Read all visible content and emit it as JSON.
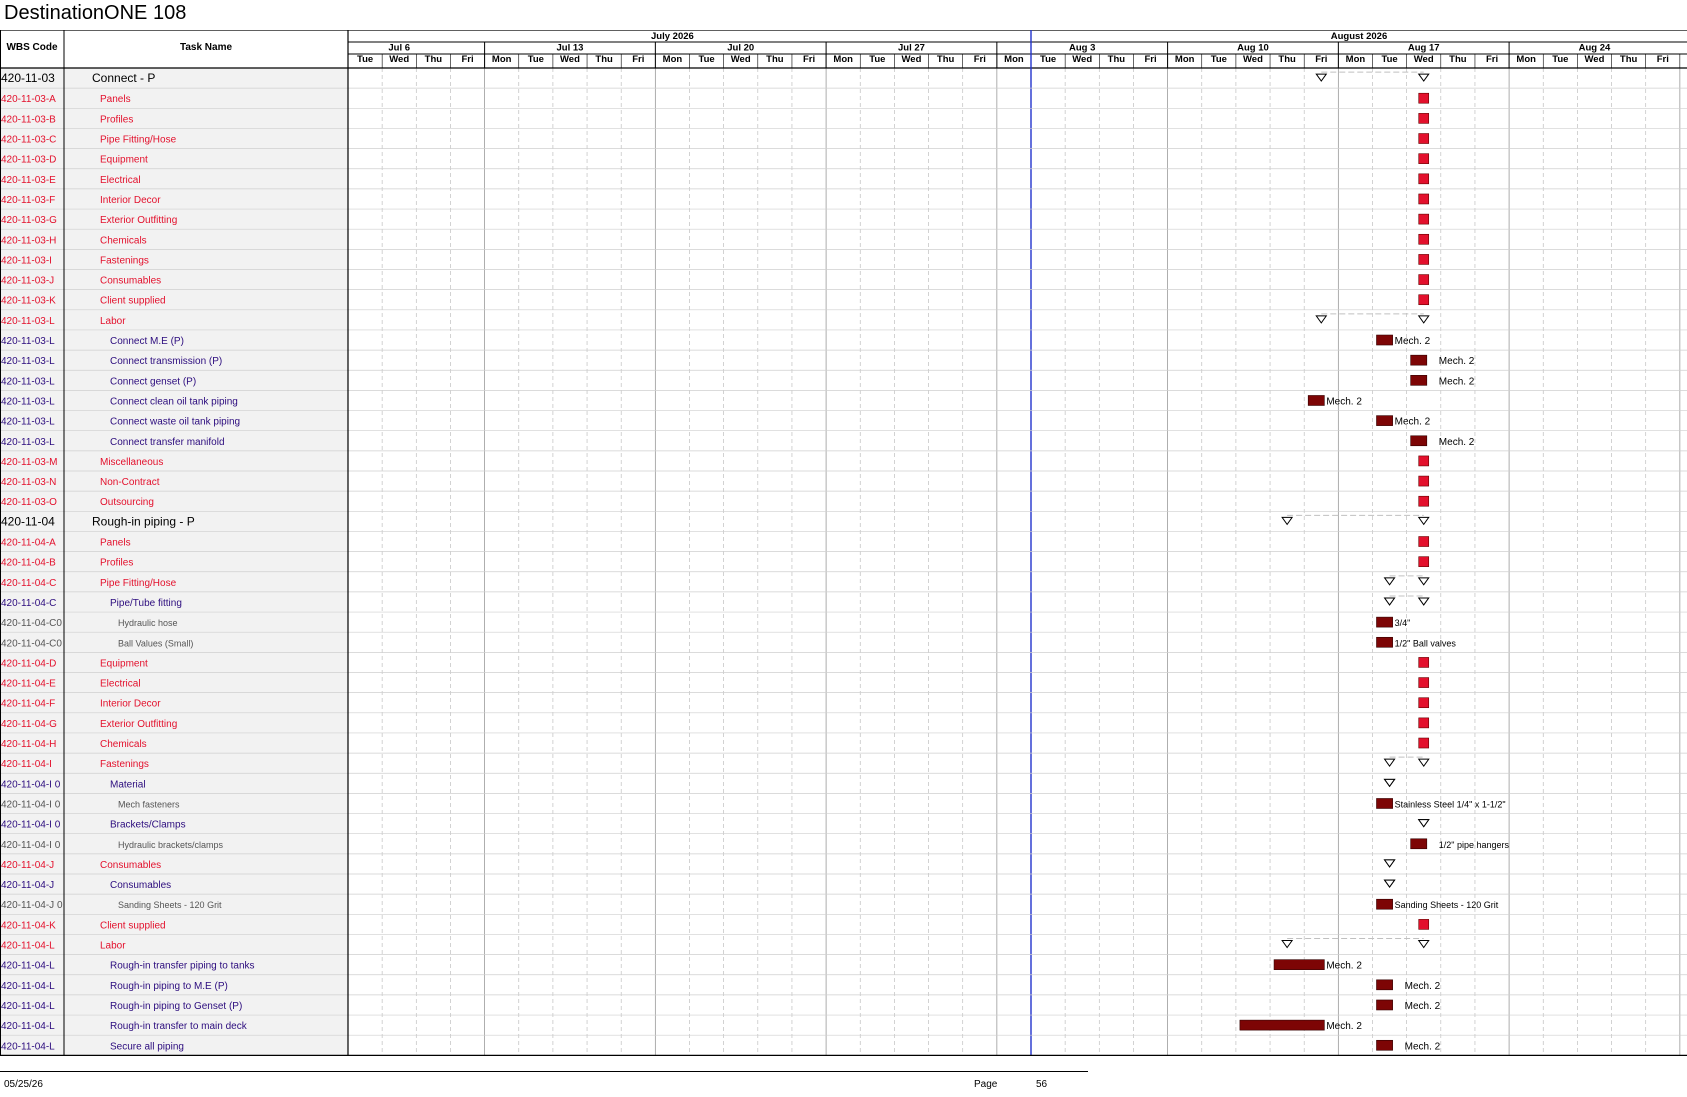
{
  "title": "DestinationONE 108",
  "headers": {
    "wbs": "WBS Code",
    "task": "Task Name"
  },
  "timescale": {
    "months": [
      {
        "label": "July 2026",
        "start": "2026-07-07",
        "end": "2026-08-01"
      },
      {
        "label": "August 2026",
        "start": "2026-08-03",
        "end": "2026-08-29"
      }
    ],
    "weeks": [
      "Jul 6",
      "Jul 13",
      "Jul 20",
      "Jul 27",
      "Aug 3",
      "Aug 10",
      "Aug 17",
      "Aug 24"
    ],
    "first_week_days": [
      "Tue",
      "Wed",
      "Thu",
      "Fri"
    ],
    "full_week_days": [
      "Mon",
      "Tue",
      "Wed",
      "Thu",
      "Fri"
    ],
    "today_line": "2026-08-03"
  },
  "rows": [
    {
      "wbs": "420-11-03",
      "name": "Connect - P",
      "level": 0,
      "kind": "summary",
      "start": "2026-08-14",
      "end": "2026-08-19"
    },
    {
      "wbs": "420-11-03-A",
      "name": "Panels",
      "level": 1,
      "kind": "milestone",
      "date": "2026-08-19"
    },
    {
      "wbs": "420-11-03-B",
      "name": "Profiles",
      "level": 1,
      "kind": "milestone",
      "date": "2026-08-19"
    },
    {
      "wbs": "420-11-03-C",
      "name": "Pipe Fitting/Hose",
      "level": 1,
      "kind": "milestone",
      "date": "2026-08-19"
    },
    {
      "wbs": "420-11-03-D",
      "name": "Equipment",
      "level": 1,
      "kind": "milestone",
      "date": "2026-08-19"
    },
    {
      "wbs": "420-11-03-E",
      "name": "Electrical",
      "level": 1,
      "kind": "milestone",
      "date": "2026-08-19"
    },
    {
      "wbs": "420-11-03-F",
      "name": "Interior Decor",
      "level": 1,
      "kind": "milestone",
      "date": "2026-08-19"
    },
    {
      "wbs": "420-11-03-G",
      "name": "Exterior Outfitting",
      "level": 1,
      "kind": "milestone",
      "date": "2026-08-19"
    },
    {
      "wbs": "420-11-03-H",
      "name": "Chemicals",
      "level": 1,
      "kind": "milestone",
      "date": "2026-08-19"
    },
    {
      "wbs": "420-11-03-I",
      "name": "Fastenings",
      "level": 1,
      "kind": "milestone",
      "date": "2026-08-19"
    },
    {
      "wbs": "420-11-03-J",
      "name": "Consumables",
      "level": 1,
      "kind": "milestone",
      "date": "2026-08-19"
    },
    {
      "wbs": "420-11-03-K",
      "name": "Client supplied",
      "level": 1,
      "kind": "milestone",
      "date": "2026-08-19"
    },
    {
      "wbs": "420-11-03-L",
      "name": "Labor",
      "level": 1,
      "kind": "summary",
      "start": "2026-08-14",
      "end": "2026-08-19"
    },
    {
      "wbs": "420-11-03-L",
      "name": "Connect M.E (P)",
      "level": 2,
      "kind": "task",
      "start": "2026-08-18",
      "end": "2026-08-18",
      "label": "Mech. 2",
      "label_pos": "near"
    },
    {
      "wbs": "420-11-03-L",
      "name": "Connect transmission (P)",
      "level": 2,
      "kind": "task",
      "start": "2026-08-19",
      "end": "2026-08-19",
      "label": "Mech. 2",
      "label_pos": "far"
    },
    {
      "wbs": "420-11-03-L",
      "name": "Connect genset (P)",
      "level": 2,
      "kind": "task",
      "start": "2026-08-19",
      "end": "2026-08-19",
      "label": "Mech. 2",
      "label_pos": "far"
    },
    {
      "wbs": "420-11-03-L",
      "name": "Connect clean oil tank piping",
      "level": 2,
      "kind": "task",
      "start": "2026-08-14",
      "end": "2026-08-14",
      "label": "Mech. 2",
      "label_pos": "near"
    },
    {
      "wbs": "420-11-03-L",
      "name": "Connect waste oil tank piping",
      "level": 2,
      "kind": "task",
      "start": "2026-08-17",
      "end": "2026-08-17",
      "label": "Mech. 2",
      "label_pos": "near"
    },
    {
      "wbs": "420-11-03-L",
      "name": "Connect transfer manifold",
      "level": 2,
      "kind": "task",
      "start": "2026-08-19",
      "end": "2026-08-19",
      "label": "Mech. 2",
      "label_pos": "far"
    },
    {
      "wbs": "420-11-03-M",
      "name": "Miscellaneous",
      "level": 1,
      "kind": "milestone",
      "date": "2026-08-19"
    },
    {
      "wbs": "420-11-03-N",
      "name": "Non-Contract",
      "level": 1,
      "kind": "milestone",
      "date": "2026-08-19"
    },
    {
      "wbs": "420-11-03-O",
      "name": "Outsourcing",
      "level": 1,
      "kind": "milestone",
      "date": "2026-08-19"
    },
    {
      "wbs": "420-11-04",
      "name": "Rough-in piping - P",
      "level": 0,
      "kind": "summary",
      "start": "2026-08-13",
      "end": "2026-08-19"
    },
    {
      "wbs": "420-11-04-A",
      "name": "Panels",
      "level": 1,
      "kind": "milestone",
      "date": "2026-08-19"
    },
    {
      "wbs": "420-11-04-B",
      "name": "Profiles",
      "level": 1,
      "kind": "milestone",
      "date": "2026-08-19"
    },
    {
      "wbs": "420-11-04-C",
      "name": "Pipe Fitting/Hose",
      "level": 1,
      "kind": "summary",
      "start": "2026-08-18",
      "end": "2026-08-19"
    },
    {
      "wbs": "420-11-04-C",
      "name": "Pipe/Tube fitting",
      "level": 2,
      "kind": "summary",
      "start": "2026-08-18",
      "end": "2026-08-19"
    },
    {
      "wbs": "420-11-04-C0",
      "name": "Hydraulic hose",
      "level": 3,
      "kind": "task",
      "start": "2026-08-17",
      "end": "2026-08-17",
      "label": "3/4\"",
      "label_pos": "near"
    },
    {
      "wbs": "420-11-04-C0",
      "name": "Ball Values (Small)",
      "level": 3,
      "kind": "task",
      "start": "2026-08-18",
      "end": "2026-08-18",
      "label": "1/2\" Ball valves",
      "label_pos": "near"
    },
    {
      "wbs": "420-11-04-D",
      "name": "Equipment",
      "level": 1,
      "kind": "milestone",
      "date": "2026-08-19"
    },
    {
      "wbs": "420-11-04-E",
      "name": "Electrical",
      "level": 1,
      "kind": "milestone",
      "date": "2026-08-19"
    },
    {
      "wbs": "420-11-04-F",
      "name": "Interior Decor",
      "level": 1,
      "kind": "milestone",
      "date": "2026-08-19"
    },
    {
      "wbs": "420-11-04-G",
      "name": "Exterior Outfitting",
      "level": 1,
      "kind": "milestone",
      "date": "2026-08-19"
    },
    {
      "wbs": "420-11-04-H",
      "name": "Chemicals",
      "level": 1,
      "kind": "milestone",
      "date": "2026-08-19"
    },
    {
      "wbs": "420-11-04-I",
      "name": "Fastenings",
      "level": 1,
      "kind": "summary",
      "start": "2026-08-17",
      "end": "2026-08-19"
    },
    {
      "wbs": "420-11-04-I 0",
      "name": "Material",
      "level": 2,
      "kind": "summary",
      "start": "2026-08-17",
      "end": "2026-08-17"
    },
    {
      "wbs": "420-11-04-I 0",
      "name": "Mech fasteners",
      "level": 3,
      "kind": "task",
      "start": "2026-08-17",
      "end": "2026-08-17",
      "label": "Stainless Steel 1/4\" x 1-1/2\"",
      "label_pos": "near"
    },
    {
      "wbs": "420-11-04-I 0",
      "name": "Brackets/Clamps",
      "level": 2,
      "kind": "summary",
      "start": "2026-08-19",
      "end": "2026-08-19"
    },
    {
      "wbs": "420-11-04-I 0",
      "name": "Hydraulic brackets/clamps",
      "level": 3,
      "kind": "task",
      "start": "2026-08-19",
      "end": "2026-08-19",
      "label": "1/2\" pipe hangers",
      "label_pos": "far"
    },
    {
      "wbs": "420-11-04-J",
      "name": "Consumables",
      "level": 1,
      "kind": "summary",
      "start": "2026-08-17",
      "end": "2026-08-17"
    },
    {
      "wbs": "420-11-04-J",
      "name": "Consumables",
      "level": 2,
      "kind": "summary",
      "start": "2026-08-17",
      "end": "2026-08-17"
    },
    {
      "wbs": "420-11-04-J 0",
      "name": "Sanding Sheets - 120 Grit",
      "level": 3,
      "kind": "task",
      "start": "2026-08-17",
      "end": "2026-08-17",
      "label": "Sanding Sheets - 120 Grit",
      "label_pos": "near"
    },
    {
      "wbs": "420-11-04-K",
      "name": "Client supplied",
      "level": 1,
      "kind": "milestone",
      "date": "2026-08-19"
    },
    {
      "wbs": "420-11-04-L",
      "name": "Labor",
      "level": 1,
      "kind": "summary",
      "start": "2026-08-13",
      "end": "2026-08-19"
    },
    {
      "wbs": "420-11-04-L",
      "name": "Rough-in transfer piping to tanks",
      "level": 2,
      "kind": "task",
      "start": "2026-08-13",
      "end": "2026-08-14",
      "label": "Mech. 2",
      "label_pos": "near"
    },
    {
      "wbs": "420-11-04-L",
      "name": "Rough-in piping to M.E (P)",
      "level": 2,
      "kind": "task",
      "start": "2026-08-17",
      "end": "2026-08-18",
      "label": "Mech. 2",
      "label_pos": "far"
    },
    {
      "wbs": "420-11-04-L",
      "name": "Rough-in piping to Genset (P)",
      "level": 2,
      "kind": "task",
      "start": "2026-08-17",
      "end": "2026-08-18",
      "label": "Mech. 2",
      "label_pos": "far"
    },
    {
      "wbs": "420-11-04-L",
      "name": "Rough-in transfer to main deck",
      "level": 2,
      "kind": "task",
      "start": "2026-08-12",
      "end": "2026-08-14",
      "label": "Mech. 2",
      "label_pos": "near"
    },
    {
      "wbs": "420-11-04-L",
      "name": "Secure all piping",
      "level": 2,
      "kind": "task",
      "start": "2026-08-17",
      "end": "2026-08-18",
      "label": "Mech. 2",
      "label_pos": "far"
    }
  ],
  "footer": {
    "date": "05/25/26",
    "page_label": "Page",
    "page_number": "56"
  },
  "colors": {
    "milestone": "#e3102c",
    "task_bar": "#7d0505",
    "level1_text": "#e3102c",
    "level2_text": "#2c0c7e",
    "level3_text": "#555555",
    "level0_text": "#000000",
    "today_line": "#2233cc",
    "gridline": "#bfbfbf",
    "table_bg": "#f2f2f2"
  }
}
